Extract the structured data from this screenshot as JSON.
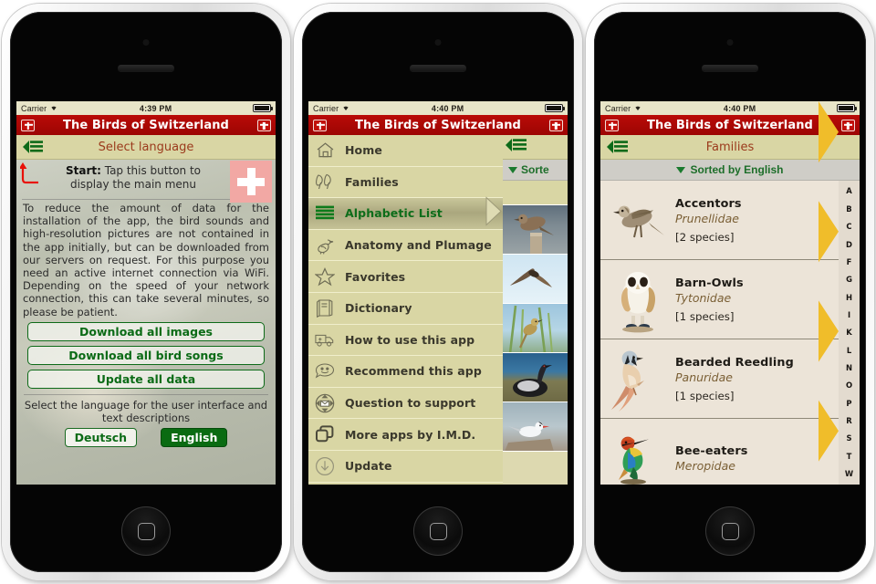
{
  "app": {
    "title": "The Birds of Switzerland",
    "nav_button_icon": "swiss-flag-icon",
    "accent_red": "#ba0b07",
    "accent_olive": "#d9d6a4",
    "accent_green": "#0b6b16",
    "title_text_color": "#9b3a1c"
  },
  "phones": [
    {
      "status": {
        "carrier": "Carrier",
        "wifi_icon": "wifi-icon",
        "time": "4:39 PM",
        "battery_icon": "battery-full-icon"
      },
      "navbar": {
        "title": "The Birds of Switzerland",
        "left_icon": "swiss-flag-icon",
        "right_icon": "swiss-flag-icon"
      },
      "toolbar": {
        "menu_icon": "back-menu-icon",
        "title": "Select language"
      },
      "hint": {
        "label": "Start:",
        "text": " Tap this button to display the main menu",
        "arrow_icon": "curved-arrow-icon",
        "flag_icon": "swiss-flag-icon"
      },
      "paragraph": "To reduce the amount of data for the installation of the app, the bird sounds and high-resolution pictures are not contained in the app initially, but can be downloaded from our servers on request. For this purpose you need an active internet connection via WiFi. Depending on the speed of your network connection, this can take several minutes, so please be patient.",
      "buttons": [
        "Download all images",
        "Download all bird songs",
        "Update all data"
      ],
      "language": {
        "label": "Select the language for the user interface and text descriptions",
        "options": [
          {
            "label": "Deutsch",
            "selected": false
          },
          {
            "label": "English",
            "selected": true
          }
        ]
      }
    },
    {
      "status": {
        "carrier": "Carrier",
        "wifi_icon": "wifi-icon",
        "time": "4:40 PM",
        "battery_icon": "battery-full-icon"
      },
      "navbar": {
        "title": "The Birds of Switzerland",
        "left_icon": "swiss-flag-icon",
        "right_icon": "swiss-flag-icon"
      },
      "menu": [
        {
          "label": "Home",
          "icon": "house-icon",
          "active": false
        },
        {
          "label": "Families",
          "icon": "feathers-icon",
          "active": false
        },
        {
          "label": "Alphabetic List",
          "icon": "list-bars-icon",
          "active": true
        },
        {
          "label": "Anatomy and Plumage",
          "icon": "bird-outline-icon",
          "active": false
        },
        {
          "label": "Favorites",
          "icon": "star-icon",
          "active": false
        },
        {
          "label": "Dictionary",
          "icon": "book-icon",
          "active": false
        },
        {
          "label": "How to use this app",
          "icon": "ambulance-icon",
          "active": false
        },
        {
          "label": "Recommend this app",
          "icon": "smiley-speech-icon",
          "active": false
        },
        {
          "label": "Question to support",
          "icon": "envelope-icon",
          "active": false
        },
        {
          "label": "More apps by I.M.D.",
          "icon": "stacked-windows-icon",
          "active": false
        },
        {
          "label": "Update",
          "icon": "download-arrow-icon",
          "active": false
        }
      ],
      "underlay": {
        "toolbar": {
          "menu_icon": "back-menu-icon"
        },
        "sortbar": {
          "caret_icon": "triangle-down-icon",
          "label": "Sorte"
        },
        "thumbnails": [
          "bird-on-post-thumb",
          "swift-in-flight-thumb",
          "warbler-on-reed-thumb",
          "diver-on-shore-thumb",
          "tern-on-rock-thumb"
        ]
      }
    },
    {
      "status": {
        "carrier": "Carrier",
        "wifi_icon": "wifi-icon",
        "time": "4:40 PM",
        "battery_icon": "battery-full-icon"
      },
      "navbar": {
        "title": "The Birds of Switzerland",
        "left_icon": "swiss-flag-icon",
        "right_icon": "swiss-flag-icon"
      },
      "toolbar": {
        "menu_icon": "back-menu-icon",
        "title": "Families"
      },
      "sortbar": {
        "caret_icon": "triangle-down-icon",
        "label": "Sorted by English"
      },
      "families": [
        {
          "name": "Accentors",
          "latin": "Prunellidae",
          "count": "[2 species]",
          "thumb": "accentor-thumb"
        },
        {
          "name": "Barn-Owls",
          "latin": "Tytonidae",
          "count": "[1 species]",
          "thumb": "barn-owl-thumb"
        },
        {
          "name": "Bearded Reedling",
          "latin": "Panuridae",
          "count": "[1 species]",
          "thumb": "bearded-reedling-thumb"
        },
        {
          "name": "Bee-eaters",
          "latin": "Meropidae",
          "count": "",
          "thumb": "bee-eater-thumb"
        }
      ],
      "index_letters": [
        "A",
        "B",
        "C",
        "D",
        "F",
        "G",
        "H",
        "I",
        "K",
        "L",
        "N",
        "O",
        "P",
        "R",
        "S",
        "T",
        "W"
      ]
    }
  ]
}
